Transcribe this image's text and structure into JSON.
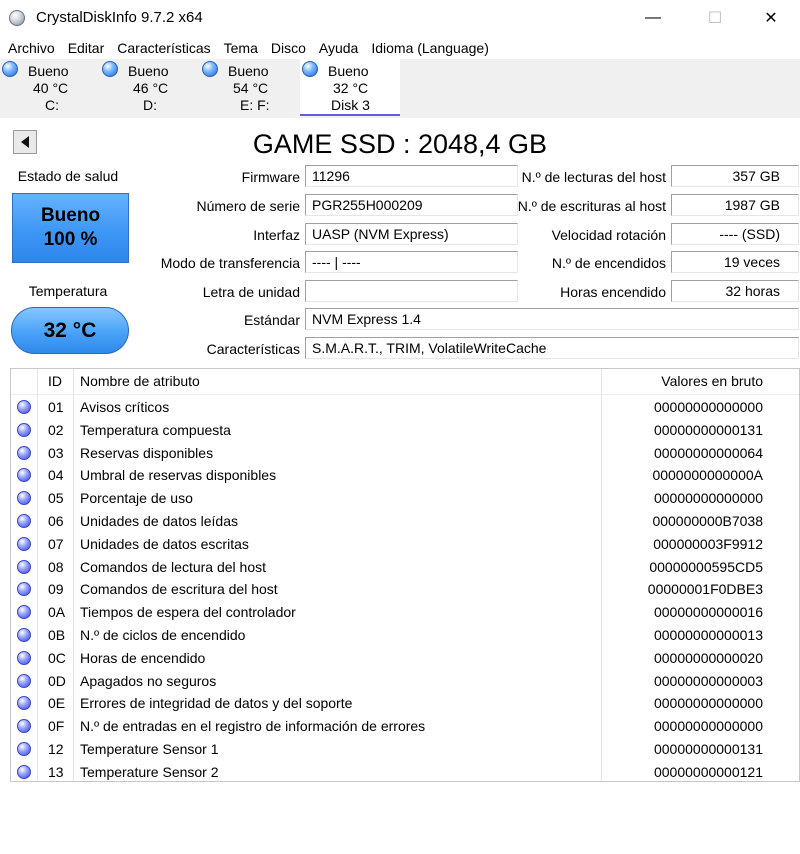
{
  "window": {
    "title": "CrystalDiskInfo 9.7.2 x64",
    "minimize_glyph": "—",
    "maximize_glyph": "☐",
    "close_glyph": "✕"
  },
  "menu": [
    "Archivo",
    "Editar",
    "Características",
    "Tema",
    "Disco",
    "Ayuda",
    "Idioma (Language)"
  ],
  "disk_tabs": [
    {
      "status": "Bueno",
      "temp": "40 °C",
      "drive": "C:"
    },
    {
      "status": "Bueno",
      "temp": "46 °C",
      "drive": "D:"
    },
    {
      "status": "Bueno",
      "temp": "54 °C",
      "drive": "E: F:"
    },
    {
      "status": "Bueno",
      "temp": "32 °C",
      "drive": "Disk 3"
    }
  ],
  "disk": {
    "title": "GAME SSD : 2048,4 GB",
    "health_label": "Estado de salud",
    "health_status": "Bueno",
    "health_percent": "100 %",
    "temperature_label": "Temperatura",
    "temperature": "32 °C"
  },
  "fields_left": [
    {
      "label": "Firmware",
      "value": "11296"
    },
    {
      "label": "Número de serie",
      "value": "PGR255H000209"
    },
    {
      "label": "Interfaz",
      "value": "UASP (NVM Express)"
    },
    {
      "label": "Modo de transferencia",
      "value": "---- | ----"
    },
    {
      "label": "Letra de unidad",
      "value": ""
    }
  ],
  "fields_right": [
    {
      "label": "N.º de lecturas del host",
      "value": "357 GB"
    },
    {
      "label": "N.º de escrituras al host",
      "value": "1987 GB"
    },
    {
      "label": "Velocidad rotación",
      "value": "---- (SSD)"
    },
    {
      "label": "N.º de encendidos",
      "value": "19 veces"
    },
    {
      "label": "Horas encendido",
      "value": "32 horas"
    }
  ],
  "fields_wide": [
    {
      "label": "Estándar",
      "value": "NVM Express 1.4"
    },
    {
      "label": "Características",
      "value": "S.M.A.R.T., TRIM, VolatileWriteCache"
    }
  ],
  "table": {
    "headers": {
      "id": "ID",
      "name": "Nombre de atributo",
      "raw": "Valores en bruto"
    },
    "rows": [
      {
        "id": "01",
        "name": "Avisos críticos",
        "raw": "00000000000000"
      },
      {
        "id": "02",
        "name": "Temperatura compuesta",
        "raw": "00000000000131"
      },
      {
        "id": "03",
        "name": "Reservas disponibles",
        "raw": "00000000000064"
      },
      {
        "id": "04",
        "name": "Umbral de reservas disponibles",
        "raw": "0000000000000A"
      },
      {
        "id": "05",
        "name": "Porcentaje de uso",
        "raw": "00000000000000"
      },
      {
        "id": "06",
        "name": "Unidades de datos leídas",
        "raw": "000000000B7038"
      },
      {
        "id": "07",
        "name": "Unidades de datos escritas",
        "raw": "000000003F9912"
      },
      {
        "id": "08",
        "name": "Comandos de lectura del host",
        "raw": "00000000595CD5"
      },
      {
        "id": "09",
        "name": "Comandos de escritura del host",
        "raw": "00000001F0DBE3"
      },
      {
        "id": "0A",
        "name": "Tiempos de espera del controlador",
        "raw": "00000000000016"
      },
      {
        "id": "0B",
        "name": "N.º de ciclos de encendido",
        "raw": "00000000000013"
      },
      {
        "id": "0C",
        "name": "Horas de encendido",
        "raw": "00000000000020"
      },
      {
        "id": "0D",
        "name": "Apagados no seguros",
        "raw": "00000000000003"
      },
      {
        "id": "0E",
        "name": "Errores de integridad de datos y del soporte",
        "raw": "00000000000000"
      },
      {
        "id": "0F",
        "name": "N.º de entradas en el registro de información de errores",
        "raw": "00000000000000"
      },
      {
        "id": "12",
        "name": "Temperature Sensor 1",
        "raw": "00000000000131"
      },
      {
        "id": "13",
        "name": "Temperature Sensor 2",
        "raw": "00000000000121"
      }
    ]
  },
  "colors": {
    "health_good": "#3d97f5",
    "status_ball": "#1f63d6",
    "selected_tab_underline": "#6b5bd6"
  }
}
